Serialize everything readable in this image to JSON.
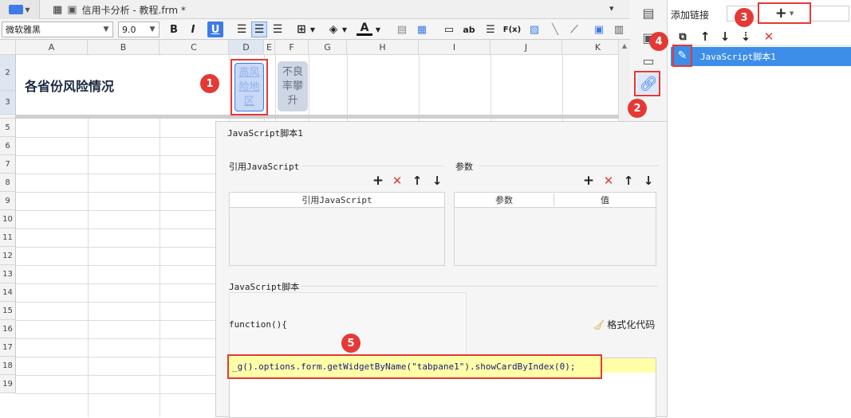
{
  "tab": {
    "title": "信用卡分析 - 教程.frm *"
  },
  "toolbar": {
    "font_name": "微软雅黑",
    "font_size": "9.0",
    "bold": "B",
    "italic": "I",
    "underline": "U",
    "text_btn": "ab",
    "formula_btn": "F(x)"
  },
  "sheet": {
    "columns": [
      "A",
      "B",
      "C",
      "D",
      "E",
      "F",
      "G",
      "H",
      "I",
      "J",
      "K"
    ],
    "rows": [
      "2",
      "3",
      "5",
      "6",
      "7",
      "8",
      "9",
      "10",
      "11",
      "12",
      "13",
      "14",
      "15",
      "16",
      "17",
      "18",
      "19"
    ],
    "title_cell": "各省份风险情况",
    "btn_high": "高风险地区",
    "btn_bad": "不良率攀升"
  },
  "right_panel": {
    "add_link_label": "添加链接",
    "add_button": "+",
    "items": [
      {
        "label": "JavaScript脚本1",
        "selected": true
      }
    ]
  },
  "dialog": {
    "title": "JavaScript脚本1",
    "ref_group": "引用JavaScript",
    "ref_header": "引用JavaScript",
    "param_group": "参数",
    "param_col1": "参数",
    "param_col2": "值",
    "script_group": "JavaScript脚本",
    "format_btn": "格式化代码",
    "function_line": "function(){",
    "code_line": "_g().options.form.getWidgetByName(\"tabpane1\").showCardByIndex(0);"
  },
  "callouts": [
    "1",
    "2",
    "3",
    "4",
    "5"
  ],
  "colors": {
    "accent": "#3d7be8",
    "callout": "#e53935",
    "selected": "#3d8ee8"
  }
}
